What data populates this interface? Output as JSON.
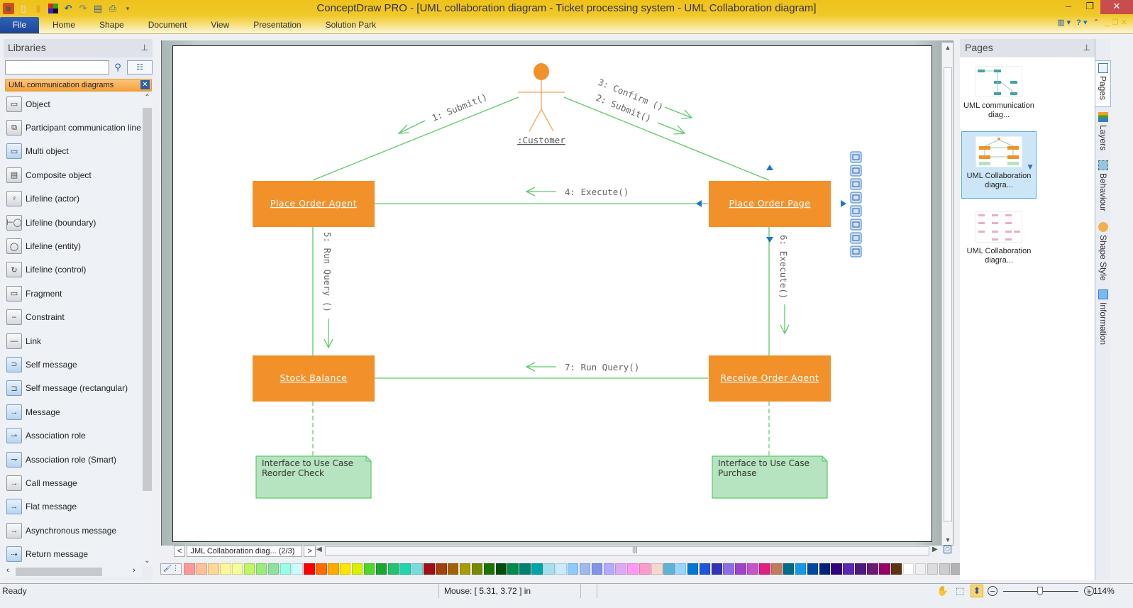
{
  "app": {
    "title": "ConceptDraw PRO - [UML collaboration diagram - Ticket processing system - UML Collaboration diagram]",
    "quick_access": [
      "app-logo",
      "new-document",
      "open-folder",
      "solution-browser",
      "undo",
      "redo",
      "save",
      "print-preview",
      "customize-dropdown"
    ],
    "window_controls": {
      "minimize": "–",
      "restore": "❐",
      "close": "✕"
    }
  },
  "ribbon": {
    "tabs": [
      "File",
      "Home",
      "Shape",
      "Document",
      "View",
      "Presentation",
      "Solution Park"
    ],
    "right_controls": {
      "layout": "▥ ▾",
      "help": "? ▾",
      "collapse": "⌃"
    }
  },
  "libraries": {
    "header": "Libraries",
    "search_placeholder": "",
    "active_library": "UML communication diagrams",
    "items": [
      {
        "label": "Object",
        "icon": "object-icon",
        "glyph": "▭",
        "blue": false
      },
      {
        "label": "Participant communication line",
        "icon": "participant-line-icon",
        "glyph": "⧉",
        "blue": false
      },
      {
        "label": "Multi object",
        "icon": "multi-object-icon",
        "glyph": "▭",
        "blue": true
      },
      {
        "label": "Composite object",
        "icon": "composite-object-icon",
        "glyph": "▤",
        "blue": false
      },
      {
        "label": "Lifeline (actor)",
        "icon": "actor-icon",
        "glyph": "♀",
        "blue": false
      },
      {
        "label": "Lifeline (boundary)",
        "icon": "boundary-icon",
        "glyph": "⊢◯",
        "blue": false
      },
      {
        "label": "Lifeline (entity)",
        "icon": "entity-icon",
        "glyph": "◯",
        "blue": false
      },
      {
        "label": "Lifeline (control)",
        "icon": "control-icon",
        "glyph": "↻",
        "blue": false
      },
      {
        "label": "Fragment",
        "icon": "fragment-icon",
        "glyph": "▭",
        "blue": false
      },
      {
        "label": "Constraint",
        "icon": "constraint-icon",
        "glyph": "┄",
        "blue": false
      },
      {
        "label": "Link",
        "icon": "link-icon",
        "glyph": "—",
        "blue": false
      },
      {
        "label": "Self message",
        "icon": "self-message-icon",
        "glyph": "⊃",
        "blue": true
      },
      {
        "label": "Self message (rectangular)",
        "icon": "self-message-rect-icon",
        "glyph": "⊐",
        "blue": true
      },
      {
        "label": "Message",
        "icon": "message-icon",
        "glyph": "→",
        "blue": true
      },
      {
        "label": "Association role",
        "icon": "association-role-icon",
        "glyph": "⇀",
        "blue": true
      },
      {
        "label": "Association role (Smart)",
        "icon": "association-role-smart-icon",
        "glyph": "⇁",
        "blue": true
      },
      {
        "label": "Call message",
        "icon": "call-message-icon",
        "glyph": "→",
        "blue": false
      },
      {
        "label": "Flat message",
        "icon": "flat-message-icon",
        "glyph": "→",
        "blue": true
      },
      {
        "label": "Asynchronous message",
        "icon": "async-message-icon",
        "glyph": "→",
        "blue": false
      },
      {
        "label": "Return message",
        "icon": "return-message-icon",
        "glyph": "⇢",
        "blue": true
      }
    ]
  },
  "diagram": {
    "actor": {
      "label": ":Customer"
    },
    "objects": [
      {
        "id": "poa",
        "label": "Place Order Agent"
      },
      {
        "id": "pop",
        "label": "Place Order Page"
      },
      {
        "id": "sb",
        "label": "Stock Balance"
      },
      {
        "id": "roa",
        "label": "Receive Order Agent"
      }
    ],
    "messages": [
      {
        "label": "1: Submit()"
      },
      {
        "label": "3: Confirm ()"
      },
      {
        "label": "2: Submit()"
      },
      {
        "label": "4: Execute()"
      },
      {
        "label": "5: Run Query ()"
      },
      {
        "label": "6: Execute()"
      },
      {
        "label": "7: Run Query()"
      }
    ],
    "notes": [
      {
        "line1": "Interface to Use Case",
        "line2": "Reorder Check"
      },
      {
        "line1": "Interface to Use Case",
        "line2": "Purchase"
      }
    ],
    "colors": {
      "object_fill": "#f2912a",
      "link": "#5cc96b",
      "note_fill": "#b7e4c0",
      "note_border": "#5cc96b",
      "actor": "#f2912a",
      "handle": "#1a78c8"
    },
    "smart_toolbar": [
      "actor-icon",
      "object-icon",
      "participant-line-icon",
      "composite-object-icon",
      "fragment-icon",
      "object-icon",
      "association-icon",
      "link-icon"
    ]
  },
  "page_nav": {
    "prev": "<",
    "current": "JML Collaboration diag... (2/3)",
    "next": ">"
  },
  "palette": {
    "colors": [
      "#ff9999",
      "#ffc099",
      "#ffd699",
      "#fff599",
      "#f5ff99",
      "#c2f566",
      "#9beb7a",
      "#8ce3a0",
      "#99ffe6",
      "#ccf9ff",
      "#ff0000",
      "#ff6a00",
      "#ffaa00",
      "#ffe600",
      "#d9ef00",
      "#52d42a",
      "#1aa632",
      "#26c26e",
      "#22d4b0",
      "#7adbdb",
      "#a00f14",
      "#a3400f",
      "#a3620a",
      "#a89b00",
      "#778a00",
      "#1b7300",
      "#004d0d",
      "#008a4b",
      "#00806e",
      "#00a6a6",
      "#a8dfee",
      "#c9eaff",
      "#8ccbff",
      "#9fb8f0",
      "#8095e8",
      "#b4aaff",
      "#dcaaf5",
      "#ff99f5",
      "#ff99cc",
      "#f7d6cc",
      "#5cb3d6",
      "#99d6ff",
      "#0078d4",
      "#1f55d9",
      "#3333b8",
      "#8c6ee8",
      "#9c44cc",
      "#c455cc",
      "#e01f80",
      "#c27a5c",
      "#006b8a",
      "#1399e6",
      "#0047a3",
      "#00237a",
      "#330080",
      "#5928b5",
      "#4d1a80",
      "#6b1a70",
      "#990066",
      "#5c3310",
      "#ffffff",
      "#efefef",
      "#dcdcdc",
      "#cccccc",
      "#b3b3b3"
    ]
  },
  "pages": {
    "header": "Pages",
    "items": [
      {
        "label1": "UML communication",
        "label2": "diag...",
        "active": false
      },
      {
        "label1": "UML Collaboration",
        "label2": "diagra...",
        "active": true
      },
      {
        "label1": "UML Collaboration",
        "label2": "diagra...",
        "active": false
      }
    ]
  },
  "side_tabs": [
    {
      "label": "Pages",
      "icon": "pages-icon"
    },
    {
      "label": "Layers",
      "icon": "layers-icon"
    },
    {
      "label": "Behaviour",
      "icon": "behaviour-icon"
    },
    {
      "label": "Shape Style",
      "icon": "shape-style-icon"
    },
    {
      "label": "Information",
      "icon": "information-icon"
    }
  ],
  "status": {
    "ready": "Ready",
    "mouse": "Mouse: [ 5.31, 3.72 ] in",
    "zoom": "114%",
    "zoom_fraction": 0.5
  }
}
